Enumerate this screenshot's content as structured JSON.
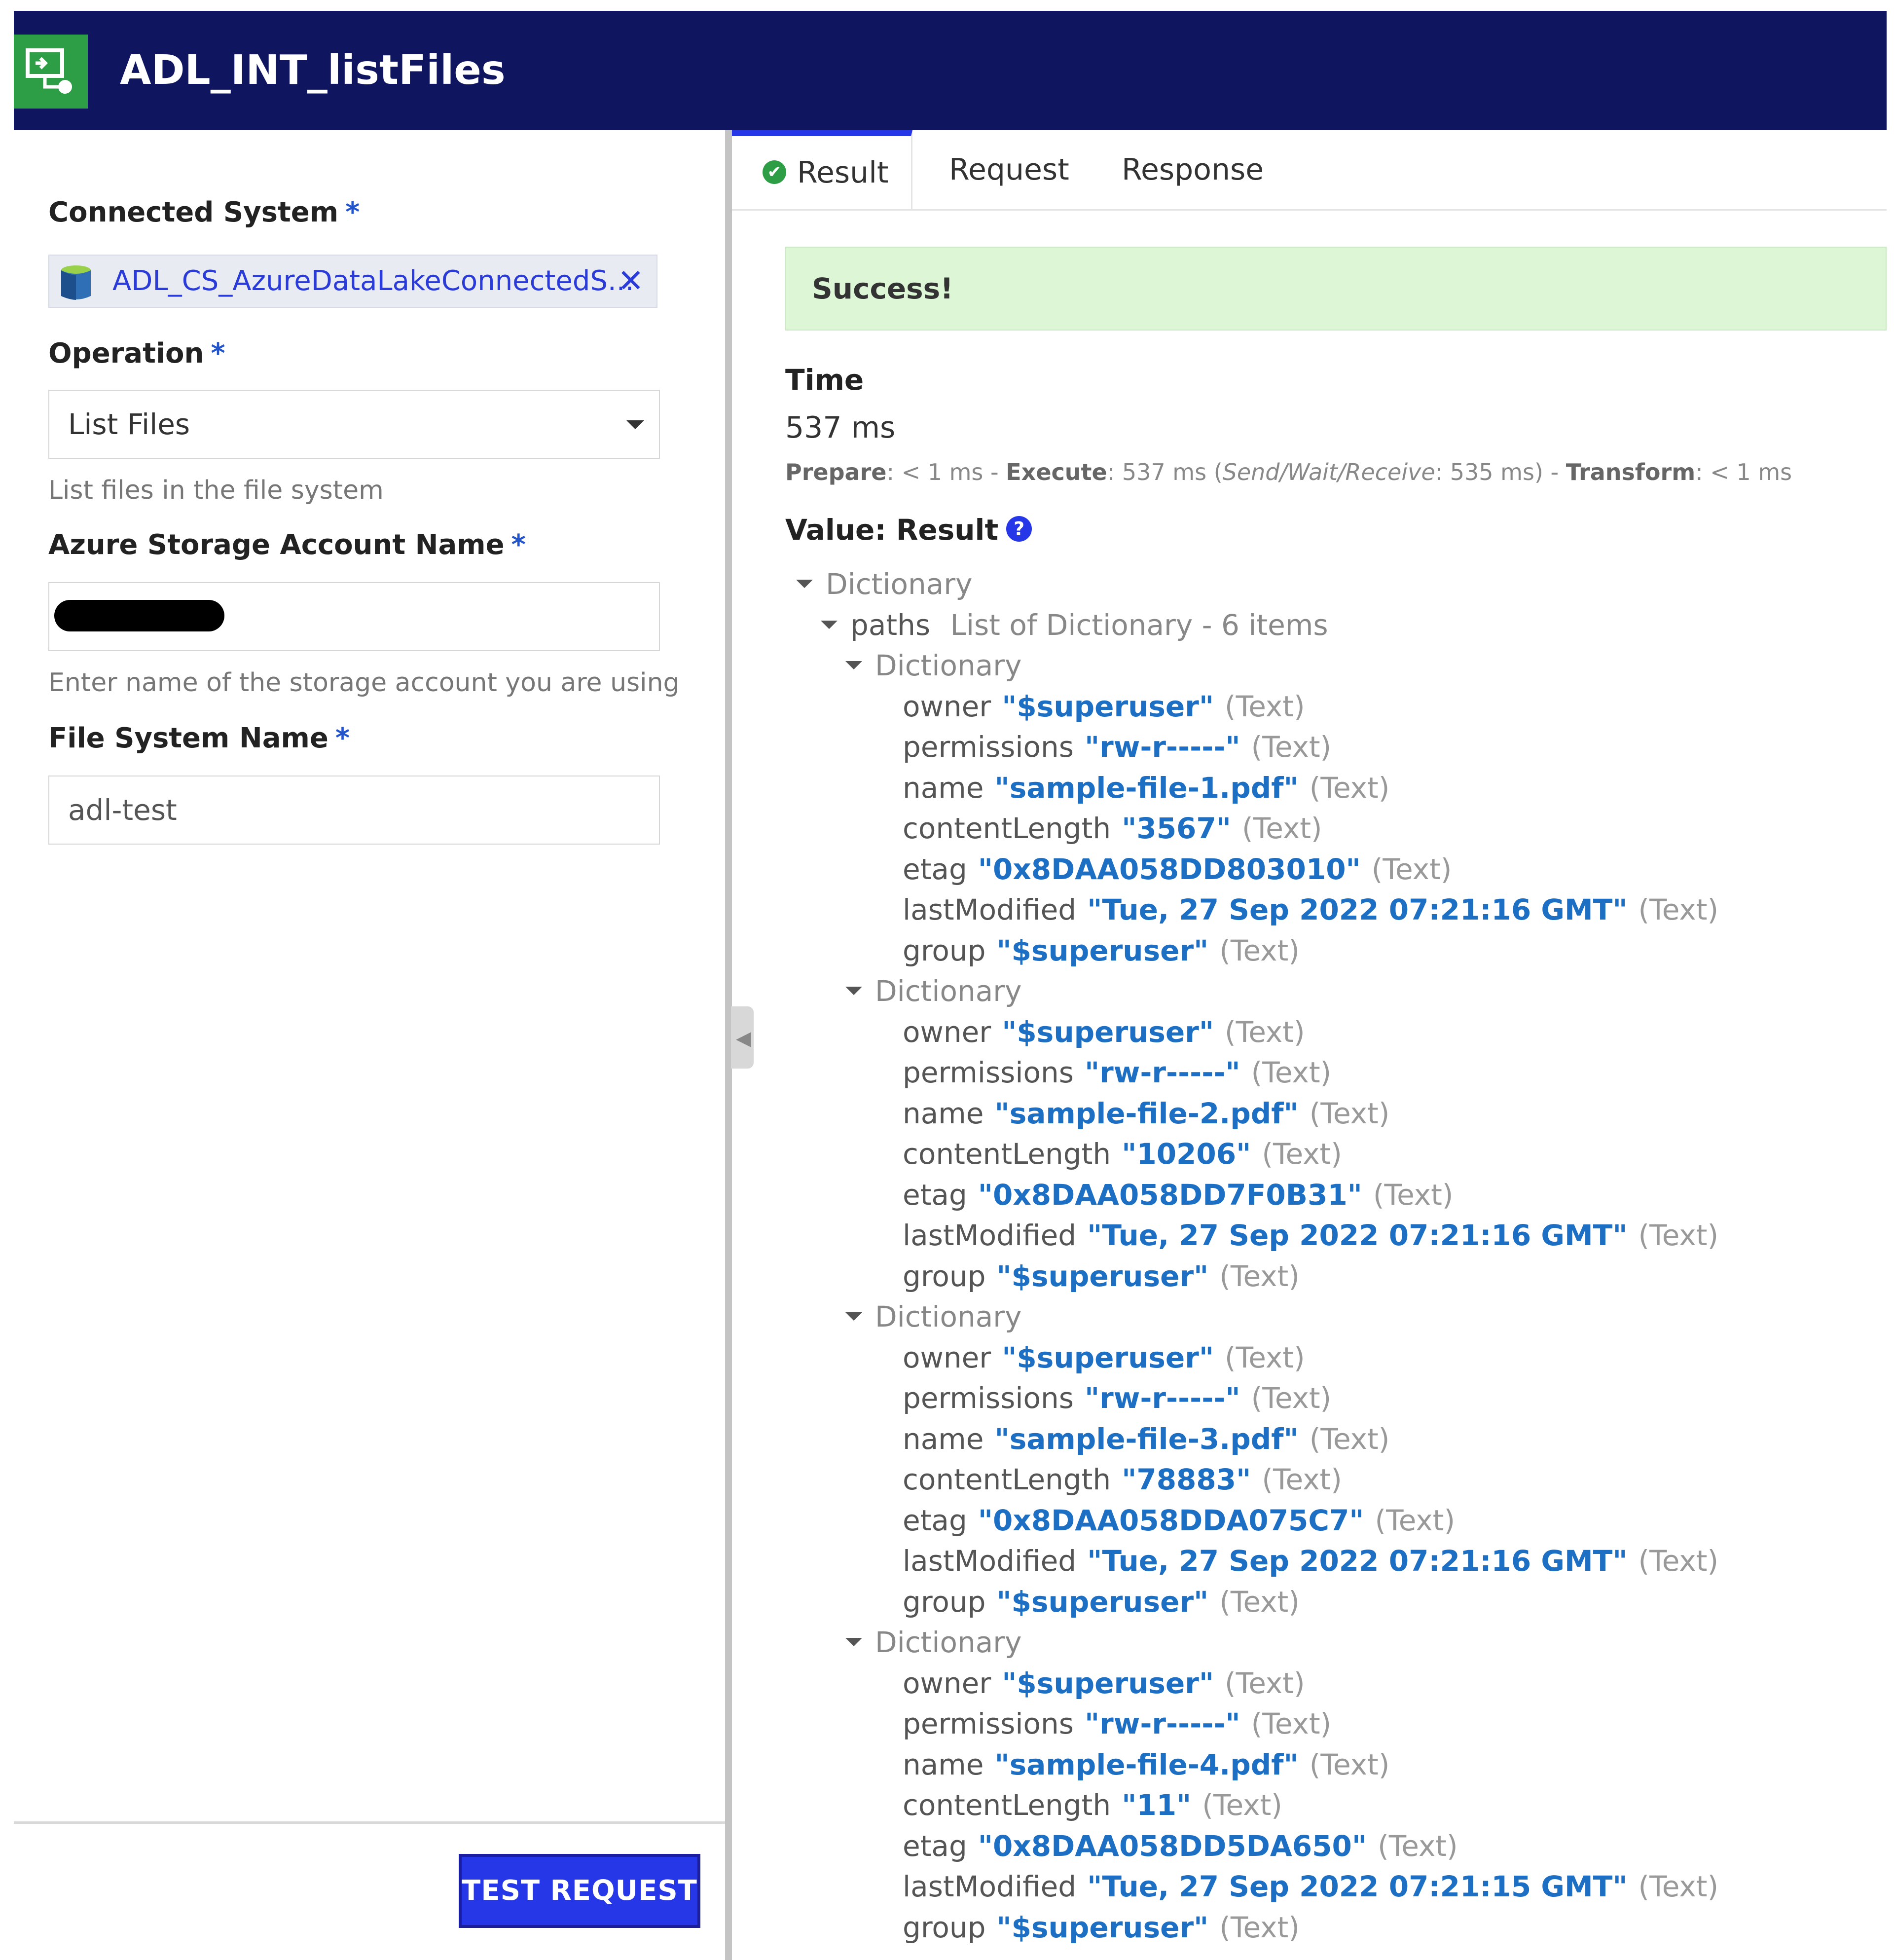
{
  "header": {
    "title": "ADL_INT_listFiles",
    "icon": "integration-icon"
  },
  "form": {
    "connected_system": {
      "label": "Connected System",
      "required_mark": "*",
      "value": "ADL_CS_AzureDataLakeConnectedS...",
      "remove": "✕"
    },
    "operation": {
      "label": "Operation",
      "required_mark": "*",
      "value": "List Files",
      "help": "List files in the file system"
    },
    "storage_account": {
      "label": "Azure Storage Account Name",
      "required_mark": "*",
      "value_redacted": true,
      "help": "Enter name of the storage account you are using"
    },
    "file_system": {
      "label": "File System Name",
      "required_mark": "*",
      "value": "adl-test"
    },
    "test_button": "TEST REQUEST"
  },
  "tabs": [
    {
      "label": "Result",
      "active": true
    },
    {
      "label": "Request",
      "active": false
    },
    {
      "label": "Response",
      "active": false
    }
  ],
  "result": {
    "banner": "Success!",
    "time_label": "Time",
    "time_value": "537 ms",
    "timing": {
      "prepare_label": "Prepare",
      "prepare": ": < 1 ms - ",
      "execute_label": "Execute",
      "execute": ": 537 ms (",
      "swr_label": "Send/Wait/Receive",
      "swr": ": 535 ms) - ",
      "transform_label": "Transform",
      "transform": ": < 1 ms"
    },
    "value_label": "Value: Result",
    "root_type": "Dictionary",
    "paths_key": "paths",
    "paths_type": "List of Dictionary - 6 items",
    "item_type": "Dictionary",
    "text_type": "(Text)",
    "items": [
      {
        "owner": "\"$superuser\"",
        "permissions": "\"rw-r-----\"",
        "name": "\"sample-file-1.pdf\"",
        "contentLength": "\"3567\"",
        "etag": "\"0x8DAA058DD803010\"",
        "lastModified": "\"Tue, 27 Sep 2022 07:21:16 GMT\"",
        "group": "\"$superuser\""
      },
      {
        "owner": "\"$superuser\"",
        "permissions": "\"rw-r-----\"",
        "name": "\"sample-file-2.pdf\"",
        "contentLength": "\"10206\"",
        "etag": "\"0x8DAA058DD7F0B31\"",
        "lastModified": "\"Tue, 27 Sep 2022 07:21:16 GMT\"",
        "group": "\"$superuser\""
      },
      {
        "owner": "\"$superuser\"",
        "permissions": "\"rw-r-----\"",
        "name": "\"sample-file-3.pdf\"",
        "contentLength": "\"78883\"",
        "etag": "\"0x8DAA058DDA075C7\"",
        "lastModified": "\"Tue, 27 Sep 2022 07:21:16 GMT\"",
        "group": "\"$superuser\""
      },
      {
        "owner": "\"$superuser\"",
        "permissions": "\"rw-r-----\"",
        "name": "\"sample-file-4.pdf\"",
        "contentLength": "\"11\"",
        "etag": "\"0x8DAA058DD5DA650\"",
        "lastModified": "\"Tue, 27 Sep 2022 07:21:15 GMT\"",
        "group": "\"$superuser\""
      }
    ],
    "field_order": [
      "owner",
      "permissions",
      "name",
      "contentLength",
      "etag",
      "lastModified",
      "group"
    ]
  }
}
